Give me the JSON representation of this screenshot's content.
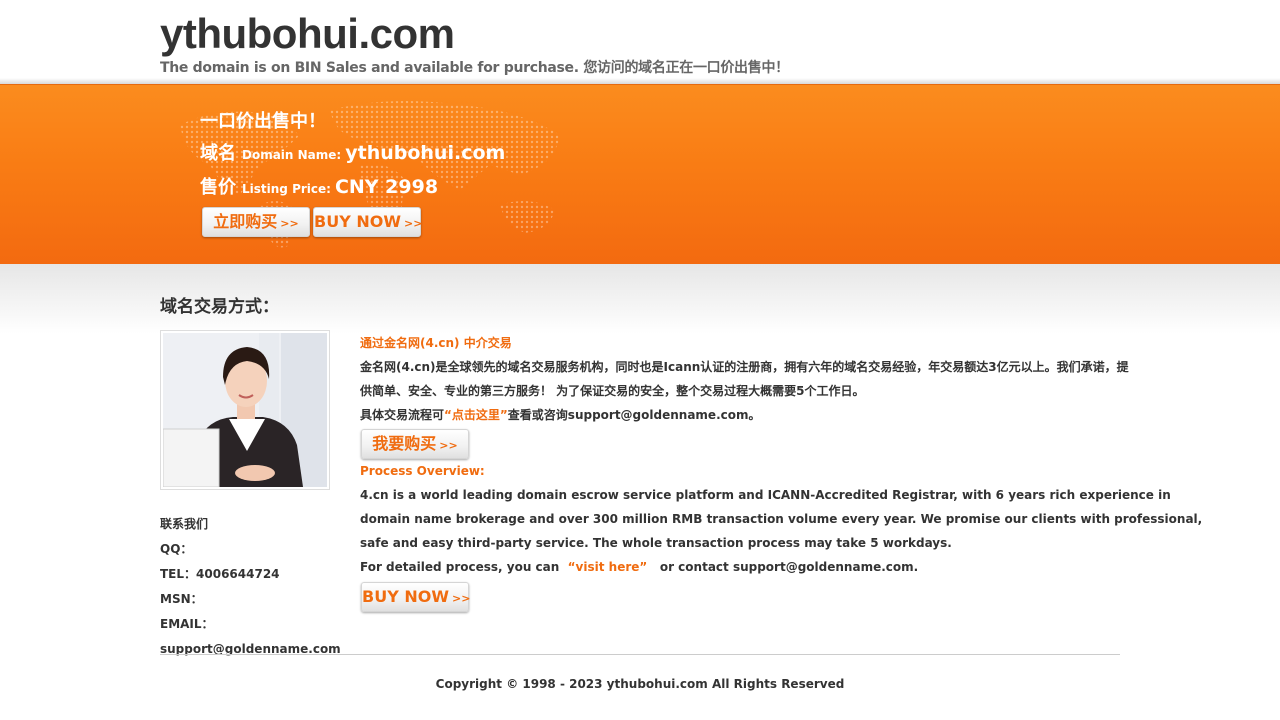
{
  "header": {
    "title": "ythubohui.com",
    "subtitle": "The domain is on BIN Sales and available for purchase. 您访问的域名正在一口价出售中！"
  },
  "banner": {
    "headline": "一口价出售中！",
    "domain_label_cn": "域名",
    "domain_label_en": "Domain Name:",
    "domain_value": "ythubohui.com",
    "price_label_cn": "售价",
    "price_label_en": "Listing Price:",
    "price_value": "CNY 2998",
    "buy_cn_label": "立即购买",
    "buy_en_label": "BUY NOW",
    "arrow": ">>"
  },
  "section": {
    "title": "域名交易方式："
  },
  "contact": {
    "heading": "联系我们",
    "qq": "QQ：",
    "tel": "TEL：4006644724",
    "msn": "MSN：",
    "email_label": "EMAIL：",
    "email": "support@goldenname.com"
  },
  "content": {
    "cn_heading": "通过金名网(4.cn) 中介交易",
    "cn_para1": "金名网(4.cn)是全球领先的域名交易服务机构，同时也是Icann认证的注册商，拥有六年的域名交易经验，年交易额达3亿元以上。我们承诺，提",
    "cn_para2": "供简单、安全、专业的第三方服务！ 为了保证交易的安全，整个交易过程大概需要5个工作日。",
    "cn_detail_prefix": "具体交易流程可",
    "cn_link": "“点击这里”",
    "cn_detail_suffix": "查看或咨询support@goldenname.com。",
    "cn_button": "我要购买",
    "en_heading": "Process Overview:",
    "en_para1": "4.cn is a world leading domain escrow service platform and ICANN-Accredited Registrar, with 6 years rich experience in",
    "en_para2": "domain name brokerage and over 300 million RMB transaction volume every year. We promise our clients with professional,",
    "en_para3": "safe and easy third-party service. The whole transaction process may take 5 workdays.",
    "en_detail_prefix": "For detailed process, you can",
    "en_link": "“visit here”",
    "en_detail_suffix": "or contact support@goldenname.com.",
    "en_button": "BUY NOW"
  },
  "footer": {
    "copyright": "Copyright © 1998 - 2023 ythubohui.com All Rights Reserved"
  },
  "colors": {
    "accent": "#f06c10",
    "banner_top": "#fb8c1e",
    "banner_bottom": "#f36a10",
    "text": "#333333"
  },
  "icons": {
    "map": "world-map-decoration",
    "photo": "customer-service-photo"
  }
}
